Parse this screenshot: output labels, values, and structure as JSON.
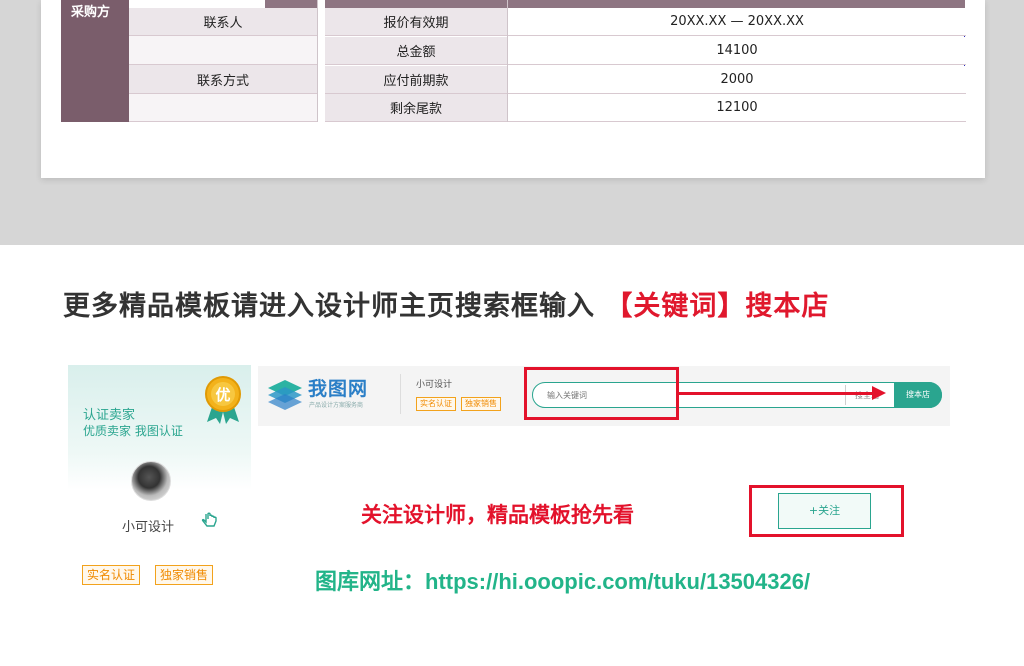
{
  "quote_table": {
    "buyer_label": "采购方",
    "left_labels": [
      "联系人",
      "",
      "联系方式",
      ""
    ],
    "fields": [
      {
        "label": "报价有效期",
        "value": "20XX.XX — 20XX.XX"
      },
      {
        "label": "总金额",
        "value": "14100"
      },
      {
        "label": "应付前期款",
        "value": "2000"
      },
      {
        "label": "剩余尾款",
        "value": "12100"
      }
    ]
  },
  "promo": {
    "headline": "更多精品模板请进入设计师主页搜索框输入",
    "headline_keyword": "【关键词】搜本店",
    "follow_text": "关注设计师，精品模板抢先看",
    "url_text": "图库网址：https://hi.ooopic.com/tuku/13504326/"
  },
  "profile": {
    "cert_title": "认证卖家",
    "cert_subtitle": "优质卖家 我图认证",
    "medal_label": "优",
    "designer_name": "小可设计",
    "tags": [
      "实名认证",
      "独家销售"
    ]
  },
  "shop_bar": {
    "logo_text": "我图网",
    "logo_subtitle": "产品设计方案服务商",
    "shop_name": "小可设计",
    "tags": [
      "实名认证",
      "独家销售"
    ],
    "search_placeholder": "输入关键词",
    "search_mid_label": "搜全站",
    "search_button": "搜本店",
    "follow_button": "+关注"
  },
  "colors": {
    "accent_green": "#2aa58f",
    "highlight_red": "#e3122b",
    "buyer_column": "#7a5d6b",
    "tag_orange": "#f08a00"
  }
}
